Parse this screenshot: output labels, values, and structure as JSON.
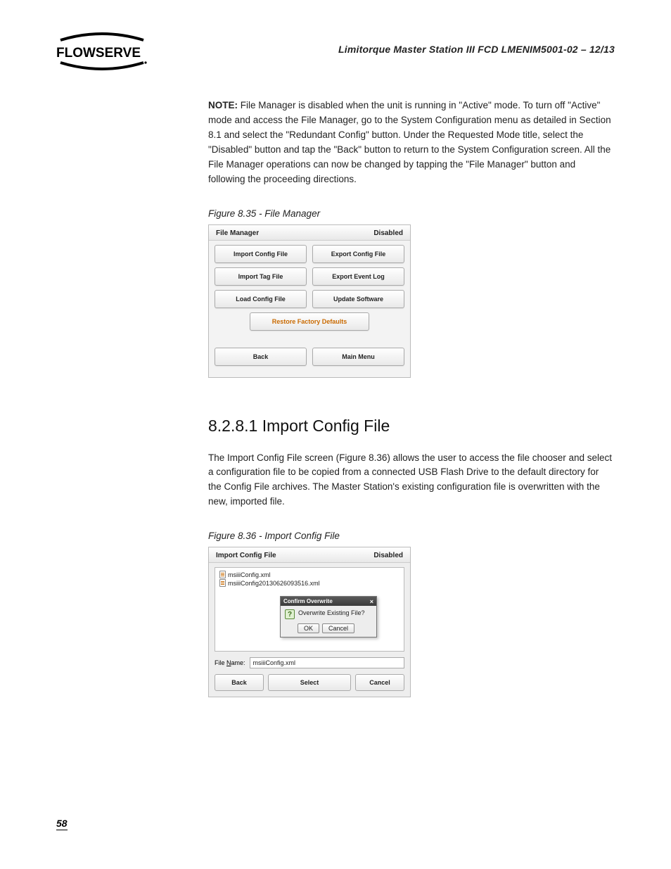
{
  "header": {
    "doc_title": "Limitorque Master Station III    FCD LMENIM5001-02 – 12/13",
    "logo_text": "FLOWSERVE"
  },
  "note": {
    "label": "NOTE:",
    "text": " File Manager is disabled when the unit is running in \"Active\" mode. To turn off \"Active\" mode and access the File Manager, go to the System Configuration menu as detailed in Section 8.1 and select the \"Redundant Config\" button. Under the Requested Mode title, select the \"Disabled\" button and tap the \"Back\" button to return to the System Configuration screen. All the File Manager operations can now be changed by tapping the \"File Manager\" button and following the proceeding directions."
  },
  "fig35": {
    "caption": "Figure 8.35 - File Manager",
    "title": "File Manager",
    "status": "Disabled",
    "buttons": {
      "import_config": "Import Config File",
      "export_config": "Export Config File",
      "import_tag": "Import Tag File",
      "export_event": "Export Event Log",
      "load_config": "Load Config File",
      "update_sw": "Update Software",
      "restore": "Restore Factory Defaults",
      "back": "Back",
      "main_menu": "Main Menu"
    }
  },
  "section": {
    "heading": "8.2.8.1 Import Config File",
    "para": "The Import Config File screen (Figure 8.36) allows the user to access the file chooser and select a configuration file to be copied from a connected USB Flash Drive to the default directory for the Config File archives. The Master Station's existing configuration file is overwritten with the new, imported file."
  },
  "fig36": {
    "caption": "Figure 8.36 - Import Config File",
    "title": "Import Config File",
    "status": "Disabled",
    "files": [
      "msiiiConfig.xml",
      "msiiiConfig20130626093516.xml"
    ],
    "dialog": {
      "title": "Confirm Overwrite",
      "message": "Overwrite Existing File?",
      "ok": "OK",
      "cancel": "Cancel"
    },
    "filename_label": "File Name:",
    "filename_value": "msiiiConfig.xml",
    "footer": {
      "back": "Back",
      "select": "Select",
      "cancel": "Cancel"
    }
  },
  "page_number": "58"
}
